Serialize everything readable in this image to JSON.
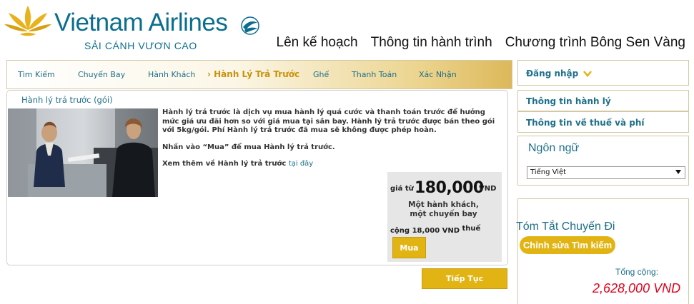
{
  "brand": {
    "name": "Vietnam Airlines",
    "slogan": "SẢI CÁNH VƯƠN CAO",
    "alliance_mark": "SKYTEAM",
    "accent_color": "#0b6e8e",
    "gold_color": "#e2b413"
  },
  "top_nav": [
    {
      "label": "Lên kế hoạch"
    },
    {
      "label": "Thông tin hành trình"
    },
    {
      "label": "Chương trình Bông Sen Vàng"
    }
  ],
  "steps": [
    {
      "label": "Tìm Kiếm"
    },
    {
      "label": "Chuyến Bay"
    },
    {
      "label": "Hành Khách"
    },
    {
      "label": "Hành Lý Trả Trước",
      "active": true,
      "marker": "›"
    },
    {
      "label": "Ghế"
    },
    {
      "label": "Thanh Toán"
    },
    {
      "label": "Xác Nhận"
    }
  ],
  "content": {
    "title": "Hành lý trả trước (gói)",
    "paragraph1": "Hành lý trả trước là dịch vụ mua hành lý quá cước và thanh toán trước để hưởng mức giá ưu đãi hơn so với giá mua tại sân bay. Hành lý trả trước được bán theo gói với 5kg/gói. Phí Hành lý trả trước đã mua sẽ không được phép hoàn.",
    "paragraph2": "Nhấn vào “Mua” để mua Hành lý trả trước.",
    "more_prefix": "Xem thêm về Hành lý trả trước",
    "more_link": "tại đây",
    "price": {
      "from_label": "giá từ",
      "amount": "180,000",
      "currency": "VND",
      "note": "Một hành khách, một chuyến bay",
      "tax_prefix": "cộng",
      "tax_amount": "18,000 VND",
      "tax_suffix": "thuế",
      "buy_label": "Mua"
    },
    "continue_label": "Tiếp Tục"
  },
  "sidebar": {
    "login_label": "Đăng nhập",
    "links": [
      {
        "label": "Thông tin hành lý"
      },
      {
        "label": "Thông tin về thuế và phí"
      }
    ],
    "language": {
      "title": "Ngôn ngữ",
      "selected": "Tiếng Việt"
    },
    "summary": {
      "title": "Tóm Tắt Chuyến Đi",
      "edit_label": "Chỉnh sửa Tìm kiếm",
      "total_label": "Tổng cộng:",
      "total_value": "2,628,000 VND",
      "total_color": "#e0001b"
    }
  }
}
